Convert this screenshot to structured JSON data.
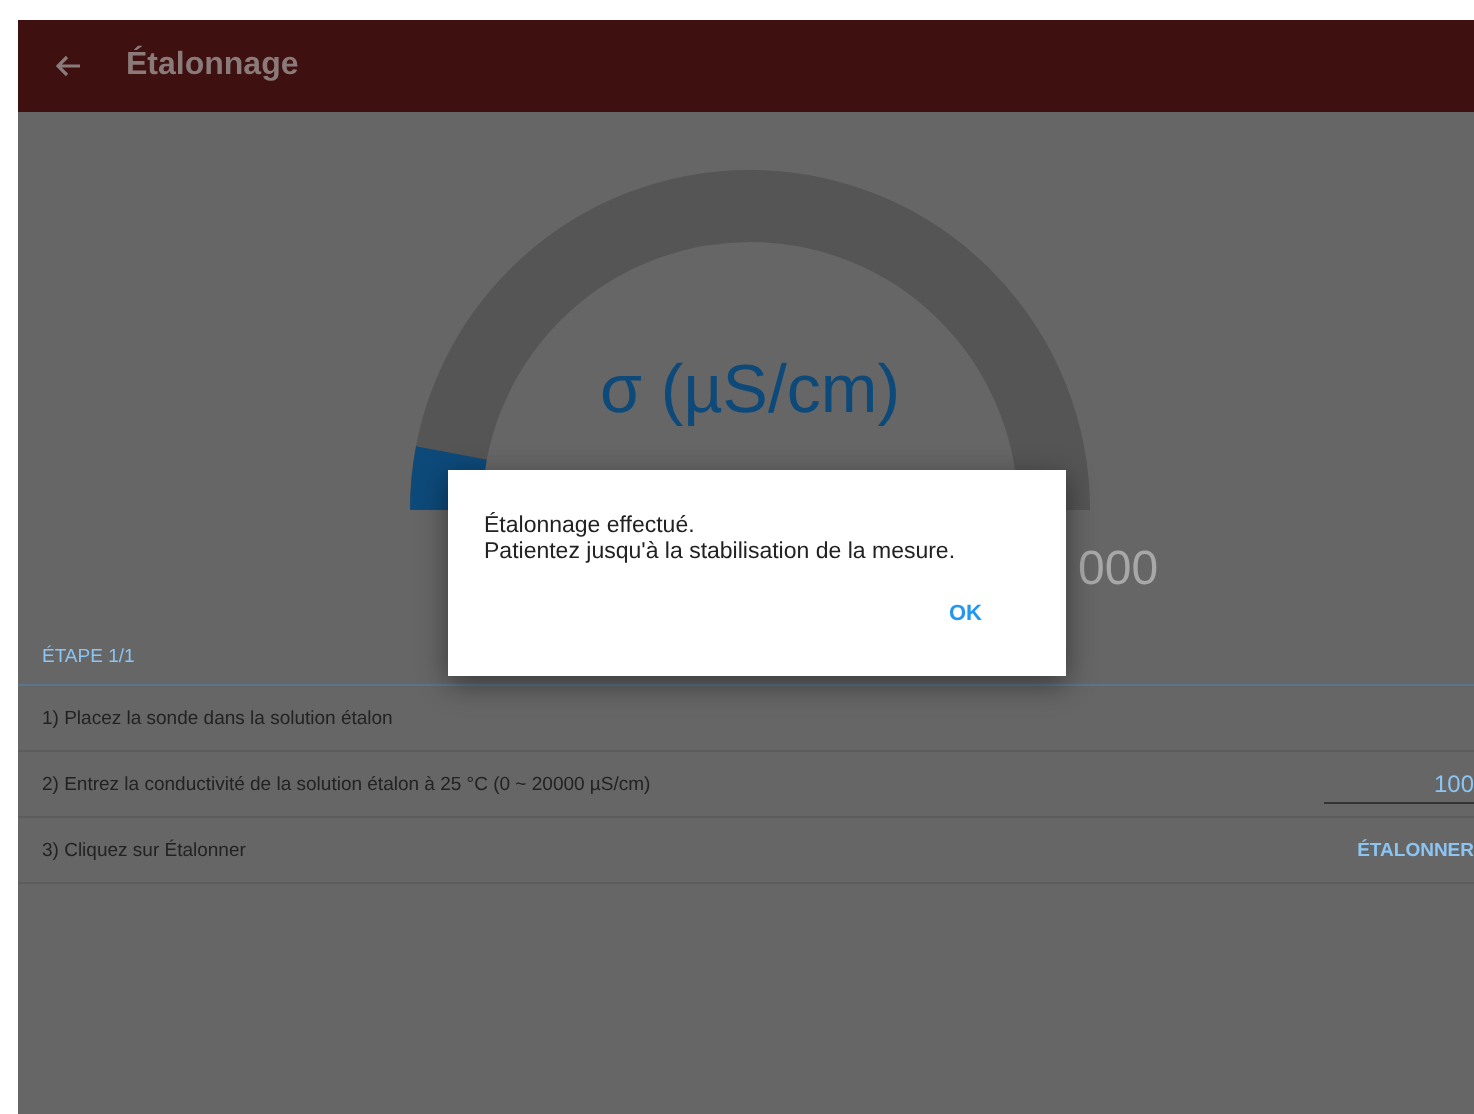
{
  "app_bar": {
    "title": "Étalonnage"
  },
  "gauge": {
    "unit": "σ (µS/cm)",
    "level": 0.06,
    "scale_max_visible": "000"
  },
  "steps": {
    "header": "ÉTAPE 1/1",
    "rows": [
      {
        "kind": "text",
        "label": "1) Placez la sonde dans la solution étalon"
      },
      {
        "kind": "input",
        "label": "2) Entrez la conductivité de la solution étalon à 25 °C (0 ~ 20000 µS/cm)",
        "value": "100"
      },
      {
        "kind": "button",
        "label": "3) Cliquez sur Étalonner",
        "action": "ÉTALONNER"
      }
    ]
  },
  "dialog": {
    "message": [
      "Étalonnage effectué.",
      "Patientez jusqu'à la stabilisation de la mesure."
    ],
    "button": "OK"
  }
}
